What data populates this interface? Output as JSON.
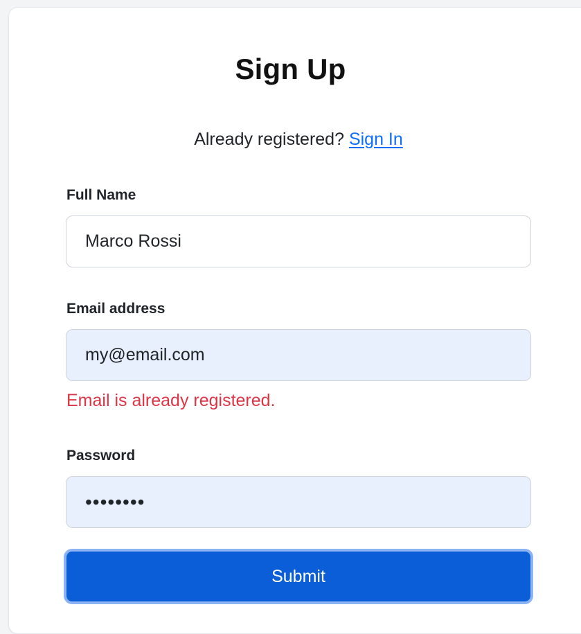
{
  "form": {
    "title": "Sign Up",
    "already_registered_text": "Already registered?",
    "sign_in_link": "Sign In",
    "full_name": {
      "label": "Full Name",
      "value": "Marco Rossi"
    },
    "email": {
      "label": "Email address",
      "value": "my@email.com",
      "error": "Email is already registered."
    },
    "password": {
      "label": "Password",
      "value": "••••••••"
    },
    "submit_label": "Submit"
  },
  "colors": {
    "link": "#0d6efd",
    "error": "#dc3545",
    "button": "#0b5ed7",
    "autofill_bg": "#e8f0fe"
  }
}
